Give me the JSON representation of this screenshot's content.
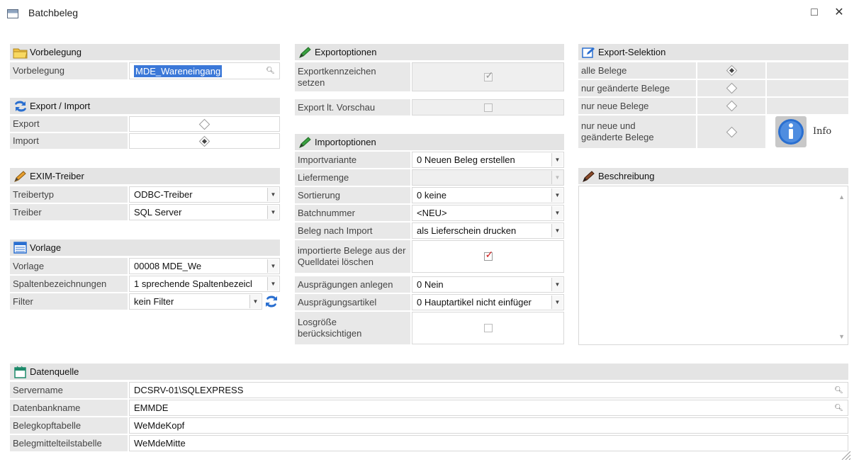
{
  "window": {
    "title": "Batchbeleg",
    "maximize": "□",
    "close": "✕"
  },
  "vorbelegung": {
    "header": "Vorbelegung",
    "label": "Vorbelegung",
    "value": "MDE_Wareneingang"
  },
  "export_import": {
    "header": "Export / Import",
    "export_label": "Export",
    "import_label": "Import",
    "export_selected": false,
    "import_selected": true
  },
  "exim": {
    "header": "EXIM-Treiber",
    "treibertyp_label": "Treibertyp",
    "treibertyp_value": "ODBC-Treiber",
    "treiber_label": "Treiber",
    "treiber_value": "SQL Server"
  },
  "vorlage": {
    "header": "Vorlage",
    "vorlage_label": "Vorlage",
    "vorlage_value": "00008 MDE_We",
    "spalten_label": "Spaltenbezeichnungen",
    "spalten_value": "1 sprechende Spaltenbezeicl",
    "filter_label": "Filter",
    "filter_value": "kein Filter"
  },
  "exportoptionen": {
    "header": "Exportoptionen",
    "kennzeichen_label": "Exportkennzeichen setzen",
    "kennzeichen_checked": true,
    "vorschau_label": "Export lt. Vorschau",
    "vorschau_checked": false
  },
  "importoptionen": {
    "header": "Importoptionen",
    "rows": {
      "importvariante_label": "Importvariante",
      "importvariante_value": "0 Neuen Beleg erstellen",
      "liefermenge_label": "Liefermenge",
      "liefermenge_value": "",
      "sortierung_label": "Sortierung",
      "sortierung_value": "0 keine",
      "batchnummer_label": "Batchnummer",
      "batchnummer_value": "<NEU>",
      "beleg_label": "Beleg nach Import",
      "beleg_value": "als Lieferschein drucken",
      "loeschen_label": "importierte Belege aus der Quelldatei löschen",
      "loeschen_checked": true,
      "auspraegungen_label": "Ausprägungen anlegen",
      "auspraegungen_value": "0 Nein",
      "artikel_label": "Ausprägungsartikel",
      "artikel_value": "0 Hauptartikel nicht einfüger",
      "losgroesse_label": "Losgröße berücksichtigen",
      "losgroesse_checked": false
    }
  },
  "export_selektion": {
    "header": "Export-Selektion",
    "options": [
      {
        "label": "alle Belege",
        "selected": true
      },
      {
        "label": "nur geänderte Belege",
        "selected": false
      },
      {
        "label": "nur neue Belege",
        "selected": false
      },
      {
        "label": "nur neue und geänderte Belege",
        "selected": false
      }
    ],
    "info_label": "Info"
  },
  "beschreibung": {
    "header": "Beschreibung",
    "text": ""
  },
  "datenquelle": {
    "header": "Datenquelle",
    "rows": [
      {
        "label": "Servername",
        "value": "DCSRV-01\\SQLEXPRESS",
        "lookup": true
      },
      {
        "label": "Datenbankname",
        "value": "EMMDE",
        "lookup": true
      },
      {
        "label": "Belegkopftabelle",
        "value": "WeMdeKopf",
        "lookup": false
      },
      {
        "label": "Belegmittelteilstabelle",
        "value": "WeMdeMitte",
        "lookup": false
      }
    ]
  },
  "colors": {
    "selection": "#3b78d8",
    "header_bg": "#e4e4e4",
    "label_bg": "#e8e8e8",
    "checkmark": "#d02020"
  }
}
